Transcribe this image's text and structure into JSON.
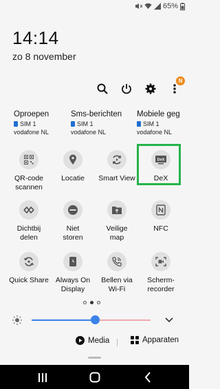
{
  "status": {
    "battery": "65%"
  },
  "time": "14:14",
  "date": "zo 8 november",
  "top_actions": {
    "badge": "N"
  },
  "sims": [
    {
      "title": "Oproepen",
      "sim": "SIM 1",
      "carrier": "vodafone NL"
    },
    {
      "title": "Sms-berichten",
      "sim": "SIM 1",
      "carrier": "vodafone NL"
    },
    {
      "title": "Mobiele geg",
      "sim": "SIM 1",
      "carrier": "vodafone NL"
    }
  ],
  "tiles": [
    {
      "label": "QR-code\nscannen",
      "icon": "qr-icon"
    },
    {
      "label": "Locatie",
      "icon": "location-icon"
    },
    {
      "label": "Smart View",
      "icon": "smart-view-icon"
    },
    {
      "label": "DeX",
      "icon": "dex-icon"
    },
    {
      "label": "Dichtbij\ndelen",
      "icon": "nearby-share-icon"
    },
    {
      "label": "Niet\nstoren",
      "icon": "do-not-disturb-icon"
    },
    {
      "label": "Veilige\nmap",
      "icon": "secure-folder-icon"
    },
    {
      "label": "NFC",
      "icon": "nfc-icon"
    },
    {
      "label": "Quick Share",
      "icon": "quick-share-icon"
    },
    {
      "label": "Always On\nDisplay",
      "icon": "always-on-display-icon"
    },
    {
      "label": "Bellen via\nWi-Fi",
      "icon": "wifi-calling-icon"
    },
    {
      "label": "Scherm-\nrecorder",
      "icon": "screen-recorder-icon"
    }
  ],
  "pager": {
    "count": 3,
    "active": 1
  },
  "brightness": {
    "level": 0.53
  },
  "media_label": "Media",
  "apparaten_label": "Apparaten",
  "colors": {
    "accent": "#3b82e6",
    "highlight": "#26b34a",
    "badge": "#f08a1c"
  }
}
